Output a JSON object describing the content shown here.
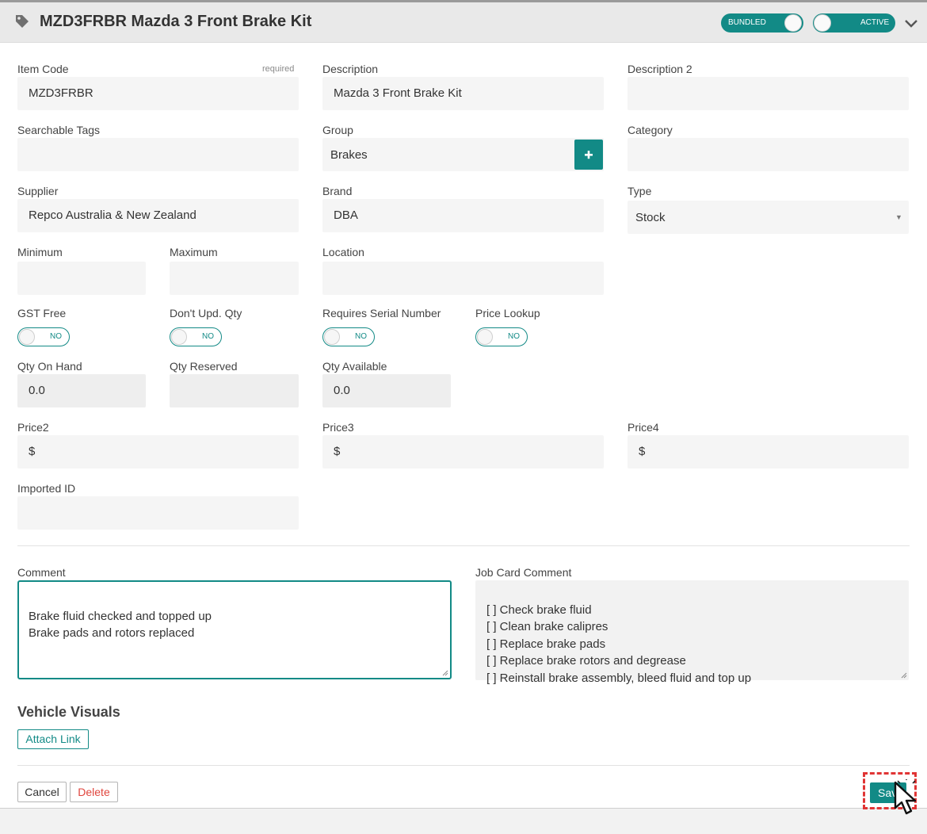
{
  "header": {
    "title": "MZD3FRBR Mazda 3 Front Brake Kit",
    "bundled_label": "BUNDLED",
    "active_label": "ACTIVE"
  },
  "fields": {
    "item_code": {
      "label": "Item Code",
      "required": "required",
      "value": "MZD3FRBR"
    },
    "description": {
      "label": "Description",
      "value": "Mazda 3 Front Brake Kit"
    },
    "description2": {
      "label": "Description 2",
      "value": ""
    },
    "searchable_tags": {
      "label": "Searchable Tags",
      "value": ""
    },
    "group": {
      "label": "Group",
      "value": "Brakes"
    },
    "category": {
      "label": "Category",
      "value": ""
    },
    "supplier": {
      "label": "Supplier",
      "value": "Repco Australia & New Zealand"
    },
    "brand": {
      "label": "Brand",
      "value": "DBA"
    },
    "type": {
      "label": "Type",
      "value": "Stock"
    },
    "minimum": {
      "label": "Minimum",
      "value": ""
    },
    "maximum": {
      "label": "Maximum",
      "value": ""
    },
    "location": {
      "label": "Location",
      "value": ""
    },
    "gst_free": {
      "label": "GST Free",
      "state": "NO"
    },
    "dont_upd_qty": {
      "label": "Don't Upd. Qty",
      "state": "NO"
    },
    "requires_serial": {
      "label": "Requires Serial Number",
      "state": "NO"
    },
    "price_lookup": {
      "label": "Price Lookup",
      "state": "NO"
    },
    "qty_on_hand": {
      "label": "Qty On Hand",
      "value": "0.0"
    },
    "qty_reserved": {
      "label": "Qty Reserved",
      "value": ""
    },
    "qty_available": {
      "label": "Qty Available",
      "value": "0.0"
    },
    "price2": {
      "label": "Price2",
      "value": "$"
    },
    "price3": {
      "label": "Price3",
      "value": "$"
    },
    "price4": {
      "label": "Price4",
      "value": "$"
    },
    "imported_id": {
      "label": "Imported ID",
      "value": ""
    }
  },
  "comments": {
    "comment_label": "Comment",
    "comment_value": "Brake fluid checked and topped up\nBrake pads and rotors replaced",
    "job_card_label": "Job Card Comment",
    "job_card_value": "[ ] Check brake fluid\n[ ] Clean brake calipres\n[ ] Replace brake pads\n[ ] Replace brake rotors and degrease\n[ ] Reinstall brake assembly, bleed fluid and top up"
  },
  "vehicle_visuals": {
    "title": "Vehicle Visuals",
    "attach_label": "Attach Link"
  },
  "footer": {
    "cancel_label": "Cancel",
    "delete_label": "Delete",
    "save_label": "Save"
  },
  "colors": {
    "accent": "#128a86",
    "delete_text": "#e0463e",
    "focus_outline": "#e03434"
  },
  "icons": {
    "tag": "tag-icon",
    "chevron": "chevron-down-icon",
    "plus": "plus-icon",
    "select": "select-arrow-icon",
    "cursor": "mouse-pointer-icon"
  }
}
